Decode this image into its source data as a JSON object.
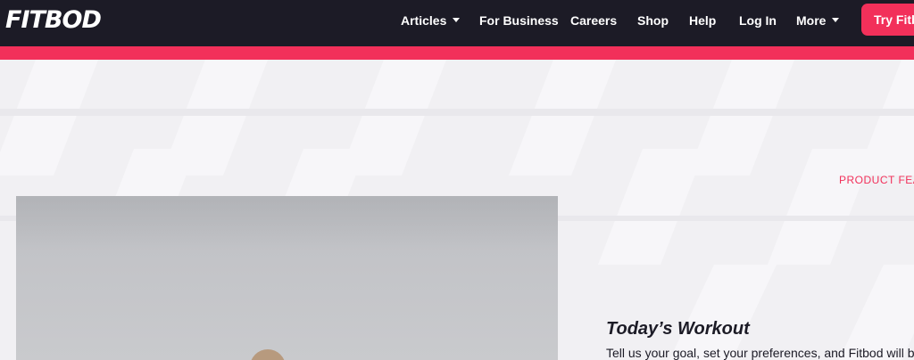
{
  "brand": {
    "logo": "FITBOD",
    "accent": "#f2305a",
    "nav_bg": "#1c1b26"
  },
  "nav": {
    "items": [
      {
        "label": "Articles",
        "has_dropdown": true
      },
      {
        "label": "For Business",
        "has_dropdown": false
      },
      {
        "label": "Careers",
        "has_dropdown": false
      },
      {
        "label": "Shop",
        "has_dropdown": false
      },
      {
        "label": "Help",
        "has_dropdown": false
      },
      {
        "label": "Log In",
        "has_dropdown": false
      },
      {
        "label": "More",
        "has_dropdown": true
      }
    ],
    "cta_label": "Try Fitbod"
  },
  "hero": {
    "eyebrow": "PRODUCT FEATURES",
    "image_icon": "workout-photo",
    "feature_title": "Today’s Workout",
    "feature_description": "Tell us your goal, set your preferences, and Fitbod will build your workout."
  }
}
